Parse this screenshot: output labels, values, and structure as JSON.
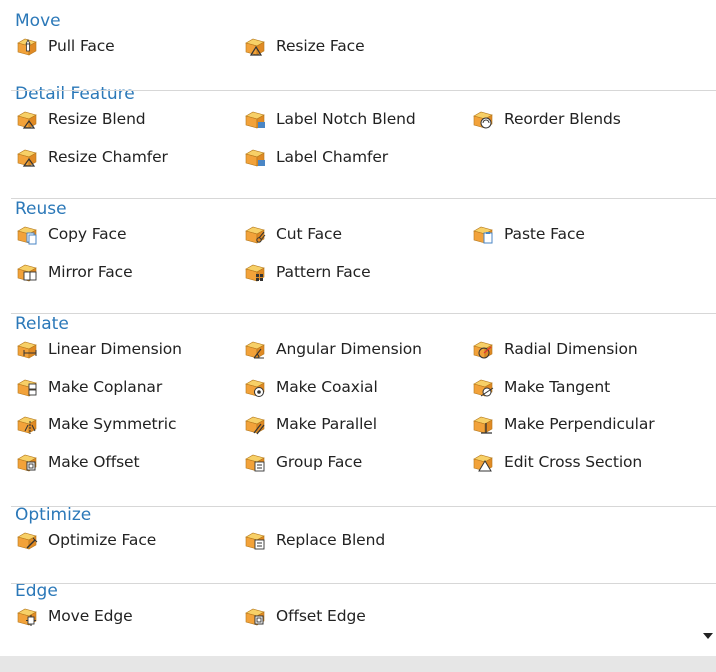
{
  "gallery": {
    "groups": [
      {
        "header": "Move",
        "items": [
          {
            "label": "Pull Face",
            "icon": "pull-face-icon"
          },
          {
            "label": "Resize Face",
            "icon": "resize-face-icon"
          }
        ]
      },
      {
        "header": "Detail Feature",
        "items": [
          {
            "label": "Resize Blend",
            "icon": "resize-blend-icon"
          },
          {
            "label": "Label Notch Blend",
            "icon": "label-notch-blend-icon"
          },
          {
            "label": "Reorder Blends",
            "icon": "reorder-blends-icon"
          },
          {
            "label": "Resize Chamfer",
            "icon": "resize-chamfer-icon"
          },
          {
            "label": "Label Chamfer",
            "icon": "label-chamfer-icon"
          }
        ]
      },
      {
        "header": "Reuse",
        "items": [
          {
            "label": "Copy Face",
            "icon": "copy-face-icon"
          },
          {
            "label": "Cut Face",
            "icon": "cut-face-icon"
          },
          {
            "label": "Paste Face",
            "icon": "paste-face-icon"
          },
          {
            "label": "Mirror Face",
            "icon": "mirror-face-icon"
          },
          {
            "label": "Pattern Face",
            "icon": "pattern-face-icon"
          }
        ]
      },
      {
        "header": "Relate",
        "items": [
          {
            "label": "Linear Dimension",
            "icon": "linear-dimension-icon"
          },
          {
            "label": "Angular Dimension",
            "icon": "angular-dimension-icon"
          },
          {
            "label": "Radial Dimension",
            "icon": "radial-dimension-icon"
          },
          {
            "label": "Make Coplanar",
            "icon": "make-coplanar-icon"
          },
          {
            "label": "Make Coaxial",
            "icon": "make-coaxial-icon"
          },
          {
            "label": "Make Tangent",
            "icon": "make-tangent-icon"
          },
          {
            "label": "Make Symmetric",
            "icon": "make-symmetric-icon"
          },
          {
            "label": "Make Parallel",
            "icon": "make-parallel-icon"
          },
          {
            "label": "Make Perpendicular",
            "icon": "make-perpendicular-icon"
          },
          {
            "label": "Make Offset",
            "icon": "make-offset-icon"
          },
          {
            "label": "Group Face",
            "icon": "group-face-icon"
          },
          {
            "label": "Edit Cross Section",
            "icon": "edit-cross-section-icon"
          }
        ]
      },
      {
        "header": "Optimize",
        "items": [
          {
            "label": "Optimize Face",
            "icon": "optimize-face-icon"
          },
          {
            "label": "Replace Blend",
            "icon": "replace-blend-icon"
          }
        ]
      },
      {
        "header": "Edge",
        "items": [
          {
            "label": "Move Edge",
            "icon": "move-edge-icon"
          },
          {
            "label": "Offset Edge",
            "icon": "offset-edge-icon"
          }
        ]
      }
    ]
  },
  "colors": {
    "header_text": "#2b78b8",
    "icon_orange": "#f2a23a",
    "icon_yellow": "#f7d067",
    "icon_blue": "#4a86c5",
    "separator": "#d7d7d7",
    "footer_bar": "#e6e6e6"
  },
  "scroll_down_icon": "triangle-down-icon"
}
